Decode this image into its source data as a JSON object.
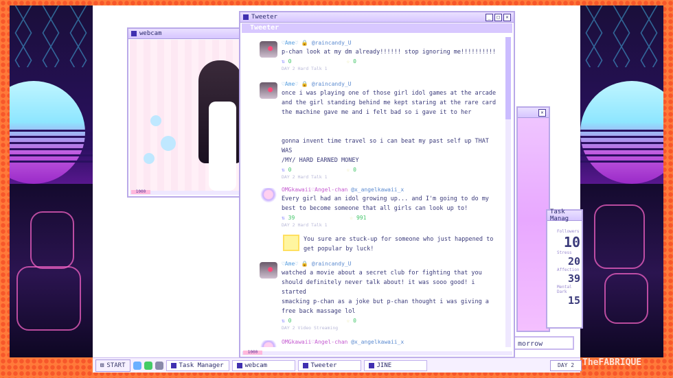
{
  "windows": {
    "webcam": {
      "title": "webcam",
      "status": "1000"
    },
    "tweeter": {
      "title": "Tweeter",
      "header": "Tweeter",
      "status": "1000"
    },
    "task_manager": {
      "title": "Task Manag",
      "stats": [
        {
          "label": "Followers",
          "value": "10"
        },
        {
          "label": "Stress",
          "value": "20"
        },
        {
          "label": "Affection",
          "value": "39"
        },
        {
          "label": "Mental Dark",
          "value": "15"
        }
      ]
    },
    "tomorrow_button": {
      "label": "morrow"
    }
  },
  "feed": {
    "tweets": [
      {
        "name": "♡Ame♡",
        "handle": "@raincandy_U",
        "text": "p-chan look at my dm already!!!!!! stop ignoring me!!!!!!!!!!",
        "retweets": "0",
        "likes": "0",
        "day": "DAY 2 Hard Talk 1"
      },
      {
        "name": "♡Ame♡",
        "handle": "@raincandy_U",
        "text": "once i was playing one of those girl idol games at the arcade\nand the girl standing behind me kept staring at the rare card\nthe machine gave me and i felt bad so i gave it to her\n\n\ngonna invent time travel so i can beat my past self up THAT WAS\n/MY/ HARD EARNED MONEY",
        "retweets": "0",
        "likes": "0",
        "day": "DAY 2 Hard Talk 1"
      },
      {
        "name": "OMGkawaii♡Angel-chan",
        "handle": "@x_angelkawaii_x",
        "text": "Every girl had an idol growing up... and I'm going to do my\nbest to become someone that all girls can look up to!",
        "retweets": "39",
        "likes": "991",
        "day": "DAY 2 Hard Talk 1",
        "angel": true
      },
      {
        "name": "♡Ame♡",
        "handle": "@raincandy_U",
        "text": "watched a movie about a secret club for fighting that you\nshould definitely never talk about! it was sooo good! i started\nsmacking p-chan as a joke but p-chan thought i was giving a\nfree back massage lol",
        "retweets": "0",
        "likes": "0",
        "day": "DAY 2 Video Streaming"
      },
      {
        "name": "OMGkawaii♡Angel-chan",
        "handle": "@x_angelkawaii_x",
        "text": "",
        "retweets": "",
        "likes": "",
        "day": "",
        "angel": true
      }
    ],
    "reply": "You sure are stuck-up for someone who just happened to\nget popular by luck!"
  },
  "taskbar": {
    "start": "START",
    "tasks": [
      "Task Manager",
      "webcam",
      "Tweeter",
      "JINE"
    ],
    "day": "DAY 2"
  },
  "watermark": "TheFABRIQUE",
  "colors": {
    "accent": "#b8a8e8",
    "background": "#ff7a3a",
    "retweet_count": "#44c66a"
  }
}
